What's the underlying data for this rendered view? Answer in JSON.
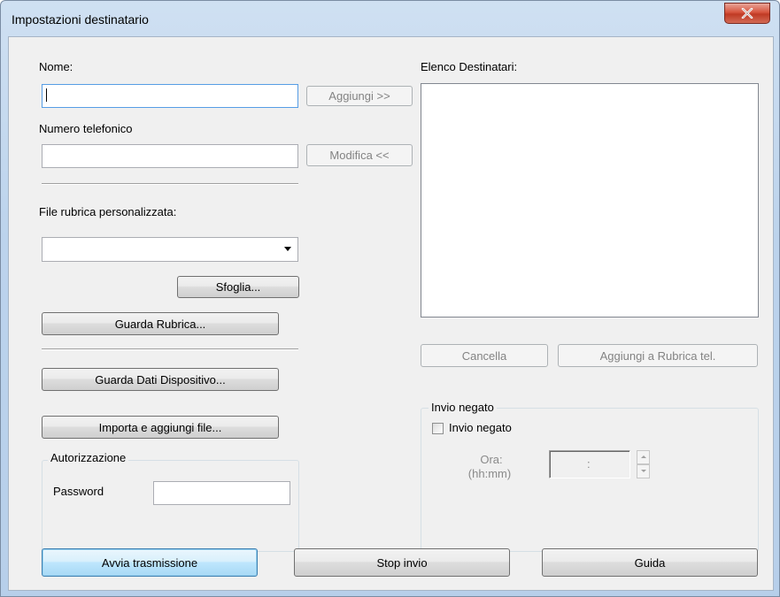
{
  "window": {
    "title": "Impostazioni destinatario"
  },
  "left": {
    "name_label": "Nome:",
    "name_value": "",
    "phone_label": "Numero telefonico",
    "phone_value": "",
    "add_button": "Aggiungi >>",
    "edit_button": "Modifica <<",
    "phonebook_file_label": "File rubrica personalizzata:",
    "phonebook_file_value": "",
    "browse_button": "Sfoglia...",
    "view_phonebook_button": "Guarda Rubrica...",
    "view_device_data_button": "Guarda Dati Dispositivo...",
    "import_add_file_button": "Importa e aggiungi file..."
  },
  "auth": {
    "group_label": "Autorizzazione",
    "password_label": "Password",
    "password_value": ""
  },
  "right": {
    "recipients_label": "Elenco Destinatari:",
    "recipients": [],
    "delete_button": "Cancella",
    "add_to_phonebook_button": "Aggiungi a Rubrica tel."
  },
  "deferred": {
    "group_label": "Invio negato",
    "checkbox_label": "Invio negato",
    "checked": false,
    "time_label_line1": "Ora:",
    "time_label_line2": "(hh:mm)",
    "time_value": ":"
  },
  "footer": {
    "start_button": "Avvia trasmissione",
    "stop_button": "Stop invio",
    "help_button": "Guida"
  }
}
